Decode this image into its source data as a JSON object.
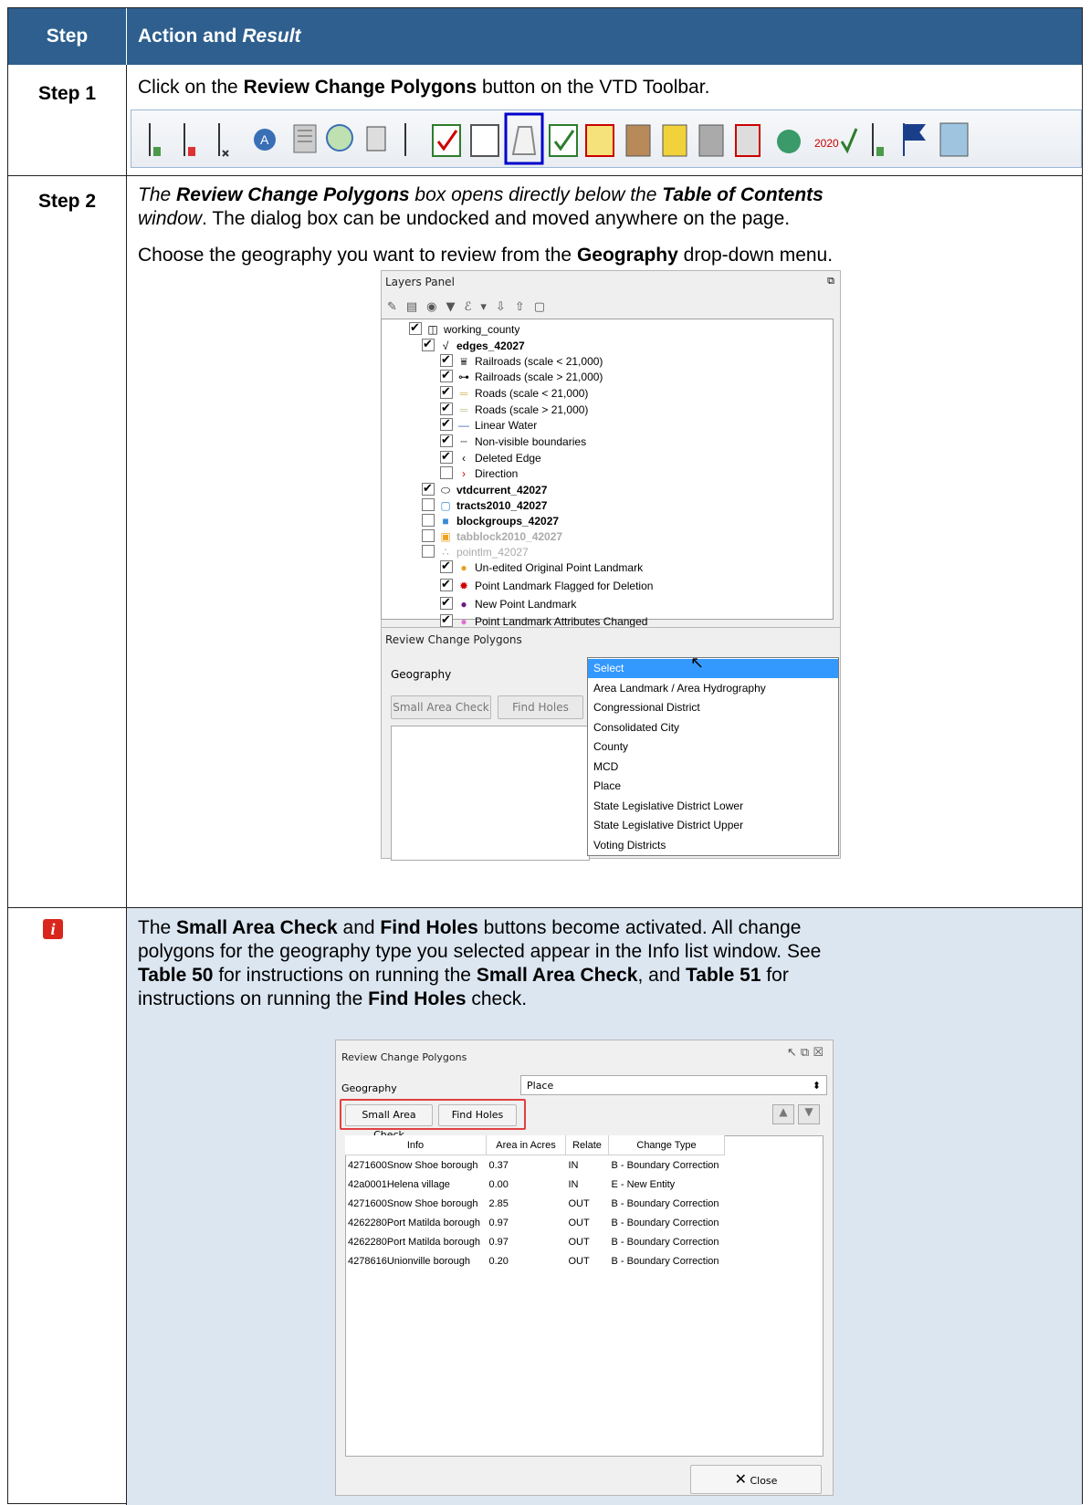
{
  "header": {
    "col1": "Step",
    "col2_a": "Action and ",
    "col2_b": "Result"
  },
  "step1": {
    "label": "Step 1",
    "text_a": "Click on the ",
    "text_b": "Review Change Polygons",
    "text_c": " button on the VTD Toolbar."
  },
  "step2": {
    "label": "Step 2",
    "p1_a": "The ",
    "p1_b": "Review Change Polygons",
    "p1_c": " box opens directly below the ",
    "p1_d": "Table of Contents",
    "p1_e": "window",
    "p1_f": ". The dialog box can be undocked and moved anywhere on the page.",
    "p2_a": "Choose the geography you want to review from the ",
    "p2_b": "Geography",
    "p2_c": " drop-down menu."
  },
  "layers_panel": {
    "title": "Layers Panel",
    "items": [
      {
        "label": "working_county",
        "bold": false
      },
      {
        "label": "edges_42027",
        "bold": true
      },
      {
        "label": "Railroads (scale < 21,000)",
        "bold": false
      },
      {
        "label": "Railroads (scale > 21,000)",
        "bold": false
      },
      {
        "label": "Roads (scale < 21,000)",
        "bold": false
      },
      {
        "label": "Roads (scale > 21,000)",
        "bold": false
      },
      {
        "label": "Linear Water",
        "bold": false
      },
      {
        "label": "Non-visible boundaries",
        "bold": false
      },
      {
        "label": "Deleted Edge",
        "bold": false
      },
      {
        "label": "Direction",
        "bold": false
      },
      {
        "label": "vtdcurrent_42027",
        "bold": true
      },
      {
        "label": "tracts2010_42027",
        "bold": true
      },
      {
        "label": "blockgroups_42027",
        "bold": true
      },
      {
        "label": "tabblock2010_42027",
        "bold": true
      },
      {
        "label": "pointlm_42027",
        "bold": false
      },
      {
        "label": "Un-edited Original Point Landmark",
        "bold": false
      },
      {
        "label": "Point Landmark Flagged for Deletion",
        "bold": false
      },
      {
        "label": "New Point Landmark",
        "bold": false
      },
      {
        "label": "Point Landmark Attributes Changed",
        "bold": false
      }
    ]
  },
  "review_panel": {
    "title": "Review Change Polygons",
    "geography_label": "Geography",
    "small_area_btn": "Small Area Check",
    "find_holes_btn": "Find Holes",
    "dropdown": [
      "Select",
      "Area Landmark / Area Hydrography",
      "Congressional District",
      "Consolidated City",
      "County",
      "MCD",
      "Place",
      "State Legislative District Lower",
      "State Legislative District Upper",
      "Voting Districts"
    ]
  },
  "info": {
    "t1": "The ",
    "t2": "Small Area Check",
    "t3": " and ",
    "t4": "Find Holes",
    "t5": " buttons become activated. All change",
    "l2": "polygons for the geography type you selected appear in the Info list window. See",
    "t6": "Table 50",
    "t7": " for instructions on running the ",
    "t8": "Small Area Check",
    "t9": ", and ",
    "t10": "Table 51",
    "t11": " for",
    "t12": "instructions on running the ",
    "t13": "Find Holes",
    "t14": " check."
  },
  "review_panel2": {
    "title": "Review Change Polygons",
    "geography_label": "Geography",
    "geography_value": "Place",
    "small_area_btn": "Small Area Check",
    "find_holes_btn": "Find Holes",
    "columns": [
      "Info",
      "Area in Acres",
      "Relate",
      "Change Type"
    ],
    "rows": [
      [
        "4271600Snow Shoe borough",
        "0.37",
        "IN",
        "B - Boundary Correction"
      ],
      [
        "42a0001Helena village",
        "0.00",
        "IN",
        "E - New Entity"
      ],
      [
        "4271600Snow Shoe borough",
        "2.85",
        "OUT",
        "B - Boundary Correction"
      ],
      [
        "4262280Port Matilda borough",
        "0.97",
        "OUT",
        "B - Boundary Correction"
      ],
      [
        "4262280Port Matilda borough",
        "0.97",
        "OUT",
        "B - Boundary Correction"
      ],
      [
        "4278616Unionville borough",
        "0.20",
        "OUT",
        "B - Boundary Correction"
      ]
    ],
    "close_btn": "Close"
  }
}
